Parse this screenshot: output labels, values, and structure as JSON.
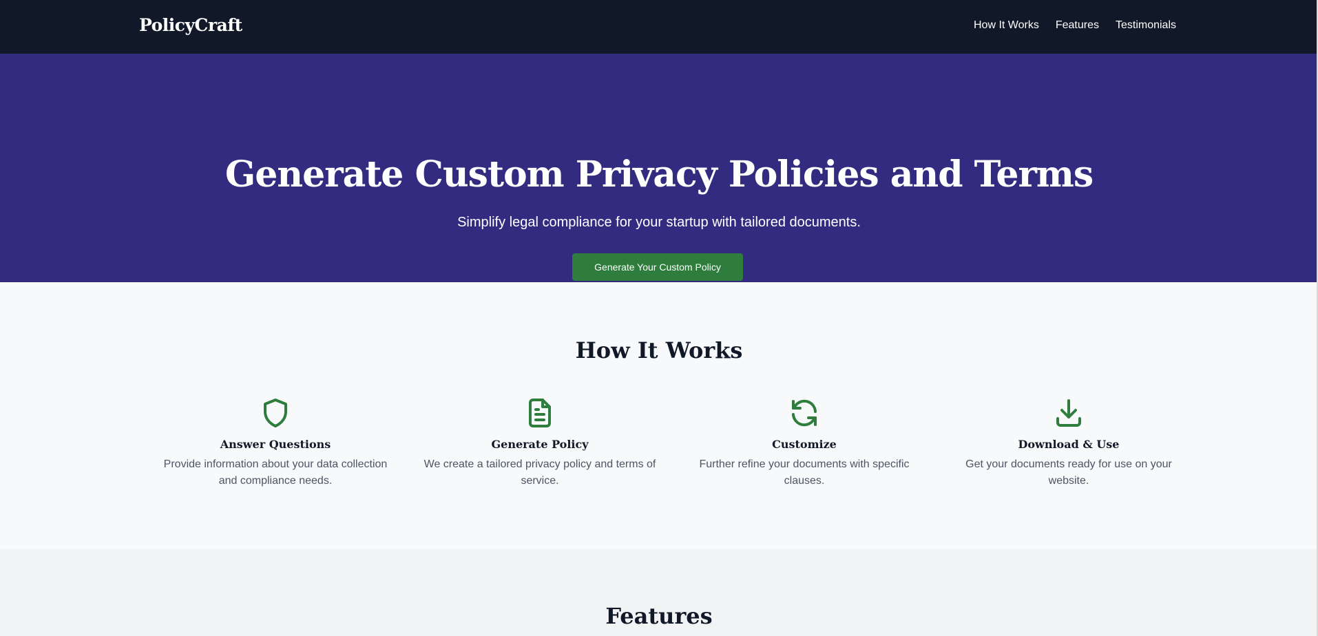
{
  "nav": {
    "brand": "PolicyCraft",
    "links": [
      "How It Works",
      "Features",
      "Testimonials"
    ]
  },
  "hero": {
    "title": "Generate Custom Privacy Policies and Terms",
    "subtitle": "Simplify legal compliance for your startup with tailored documents.",
    "cta_label": "Generate Your Custom Policy"
  },
  "how_it_works": {
    "heading": "How It Works",
    "steps": [
      {
        "icon": "shield-icon",
        "title": "Answer Questions",
        "text": "Provide information about your data collection and compliance needs."
      },
      {
        "icon": "document-icon",
        "title": "Generate Policy",
        "text": "We create a tailored privacy policy and terms of service."
      },
      {
        "icon": "refresh-icon",
        "title": "Customize",
        "text": "Further refine your documents with specific clauses."
      },
      {
        "icon": "download-icon",
        "title": "Download & Use",
        "text": "Get your documents ready for use on your website."
      }
    ]
  },
  "features": {
    "heading": "Features"
  },
  "colors": {
    "navbar": "#111827",
    "hero": "#322b80",
    "accent": "#2f7d3c",
    "icon": "#2f7d3c"
  }
}
